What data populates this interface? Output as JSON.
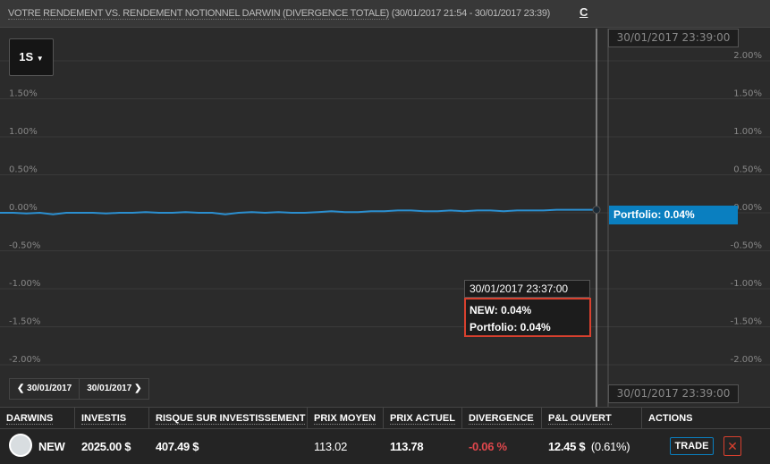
{
  "header": {
    "title": "VOTRE RENDEMENT VS. RENDEMENT NOTIONNEL DARWIN (DIVERGENCE TOTALE)",
    "range": "(30/01/2017 21:54 - 30/01/2017 23:39)",
    "refresh_icon": "refresh-icon"
  },
  "period": {
    "label": "1S"
  },
  "crosshair": {
    "top_time": "30/01/2017 23:39:00",
    "bottom_time": "30/01/2017 23:39:00",
    "portfolio_label": "Portfolio: 0.04%"
  },
  "tooltip": {
    "time": "30/01/2017 23:37:00",
    "new": "NEW: 0.04%",
    "portfolio": "Portfolio: 0.04%"
  },
  "nav": {
    "prev": "30/01/2017",
    "next": "30/01/2017"
  },
  "chart_data": {
    "type": "line",
    "left_ticks": [
      "1.50%",
      "1.00%",
      "0.50%",
      "0.00%",
      "-0.50%",
      "-1.00%",
      "-1.50%",
      "-2.00%"
    ],
    "right_ticks": [
      "2.00%",
      "1.50%",
      "1.00%",
      "0.50%",
      "0.00%",
      "-0.50%",
      "-1.00%",
      "-1.50%",
      "-2.00%"
    ],
    "ylim": [
      -2.0,
      2.0
    ],
    "series": [
      {
        "name": "Portfolio",
        "color": "#2b8fd0",
        "values": [
          0.0,
          0.0,
          -0.01,
          0.0,
          -0.02,
          0.0,
          0.0,
          0.0,
          -0.01,
          0.0,
          0.0,
          0.01,
          0.0,
          0.0,
          0.01,
          0.0,
          0.0,
          -0.02,
          0.0,
          0.01,
          0.0,
          0.01,
          0.0,
          0.0,
          0.01,
          0.02,
          0.01,
          0.01,
          0.02,
          0.02,
          0.03,
          0.03,
          0.02,
          0.02,
          0.03,
          0.02,
          0.03,
          0.03,
          0.02,
          0.03,
          0.03,
          0.03,
          0.04,
          0.04,
          0.04,
          0.04
        ]
      }
    ]
  },
  "table": {
    "headers": [
      "DARWINS",
      "INVESTIS",
      "RISQUE SUR INVESTISSEMENT",
      "PRIX MOYEN",
      "PRIX ACTUEL",
      "DIVERGENCE",
      "P&L OUVERT",
      "ACTIONS"
    ],
    "row": {
      "darwin": "NEW",
      "investis": "2025.00 $",
      "risque": "407.49 $",
      "prix_moyen": "113.02",
      "prix_actuel": "113.78",
      "divergence": "-0.06 %",
      "pl": "12.45 $",
      "pl_pct": "(0.61%)",
      "trade": "TRADE",
      "close": "✕"
    },
    "divergence_color": "#e0474c"
  }
}
